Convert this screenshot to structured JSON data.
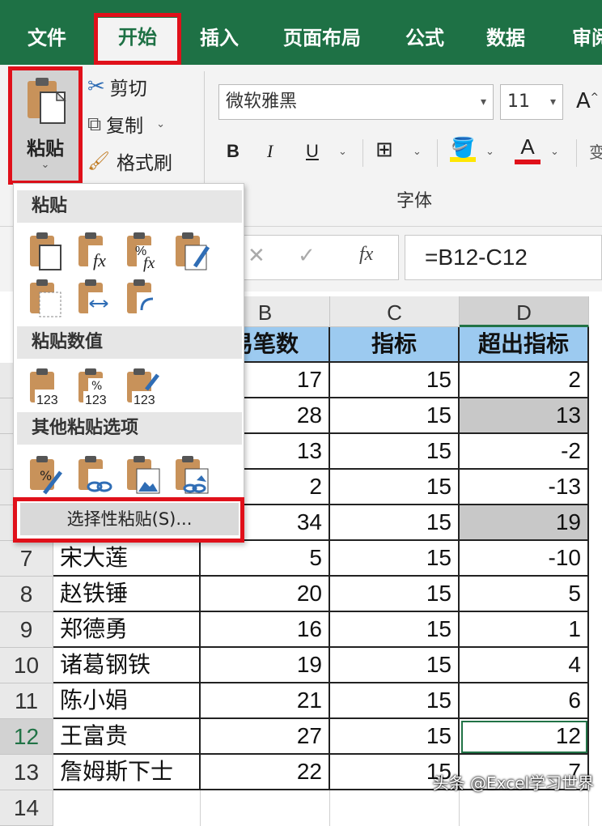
{
  "tabs": [
    "文件",
    "开始",
    "插入",
    "页面布局",
    "公式",
    "数据",
    "审阅"
  ],
  "clipboard": {
    "paste": "粘贴",
    "cut": "剪切",
    "copy": "复制",
    "format_painter": "格式刷"
  },
  "font": {
    "name": "微软雅黑",
    "size": "11",
    "group_label": "字体",
    "bold": "B",
    "italic": "I",
    "underline": "U",
    "font_color": "A",
    "grow": "A",
    "highlight_color": "#ffe600",
    "text_color": "#e0101a"
  },
  "formula_bar": {
    "cancel": "✕",
    "enter": "✓",
    "fx": "fx",
    "formula": "=B12-C12"
  },
  "columns": [
    "B",
    "C",
    "D"
  ],
  "headers": {
    "b": "易笔数",
    "c": "指标",
    "d": "超出指标"
  },
  "rows": [
    {
      "num": "",
      "name": "",
      "b": "17",
      "c": "15",
      "d": "2"
    },
    {
      "num": "",
      "name": "",
      "b": "28",
      "c": "15",
      "d": "13"
    },
    {
      "num": "",
      "name": "",
      "b": "13",
      "c": "15",
      "d": "-2"
    },
    {
      "num": "",
      "name": "",
      "b": "2",
      "c": "15",
      "d": "-13"
    },
    {
      "num": "",
      "name": "",
      "b": "34",
      "c": "15",
      "d": "19"
    },
    {
      "num": "7",
      "name": "宋大莲",
      "b": "5",
      "c": "15",
      "d": "-10"
    },
    {
      "num": "8",
      "name": "赵铁锤",
      "b": "20",
      "c": "15",
      "d": "5"
    },
    {
      "num": "9",
      "name": "郑德勇",
      "b": "16",
      "c": "15",
      "d": "1"
    },
    {
      "num": "10",
      "name": "诸葛钢铁",
      "b": "19",
      "c": "15",
      "d": "4"
    },
    {
      "num": "11",
      "name": "陈小娟",
      "b": "21",
      "c": "15",
      "d": "6"
    },
    {
      "num": "12",
      "name": "王富贵",
      "b": "27",
      "c": "15",
      "d": "12"
    },
    {
      "num": "13",
      "name": "詹姆斯下士",
      "b": "22",
      "c": "15",
      "d": "7"
    },
    {
      "num": "14",
      "name": "",
      "b": "",
      "c": "",
      "d": ""
    }
  ],
  "paste_menu": {
    "section_paste": "粘贴",
    "section_values": "粘贴数值",
    "section_other": "其他粘贴选项",
    "paste_special": "选择性粘贴(S)...",
    "value_badge": "123",
    "percent_badge": "%",
    "fx_badge": "fx"
  },
  "watermark": "头条 @Excel学习世界"
}
